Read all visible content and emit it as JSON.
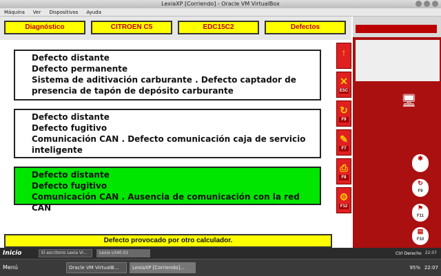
{
  "host": {
    "title": "LexiaXP [Corriendo] - Oracle VM VirtualBox",
    "menu": [
      "Máquina",
      "Ver",
      "Dispositivos",
      "Ayuda"
    ]
  },
  "guest": {
    "top_buttons": [
      "Diagnóstico",
      "CITROEN C5",
      "EDC15C2",
      "Defectos"
    ],
    "defects": [
      {
        "lines": [
          "Defecto distante",
          "Defecto permanente",
          "Sistema de aditivación carburante . Defecto captador de presencia de tapón de depósito carburante"
        ],
        "highlight": false
      },
      {
        "lines": [
          "Defecto distante",
          "Defecto fugitivo",
          "Comunicación CAN . Defecto comunicación caja de servicio inteligente"
        ],
        "highlight": true
      },
      {
        "lines": [
          "Defecto distante",
          "Defecto fugitivo",
          "Comunicación CAN . Ausencia de comunicación con la red CAN"
        ],
        "highlight": true
      }
    ],
    "status_message": "Defecto provocado por otro calculador.",
    "tool_buttons": [
      {
        "icon": "arrow-up-icon",
        "key": ""
      },
      {
        "icon": "erase-icon",
        "key": "ESC"
      },
      {
        "icon": "refresh-icon",
        "key": "F9"
      },
      {
        "icon": "pencil-icon",
        "key": "F7"
      },
      {
        "icon": "print-icon",
        "key": "F8"
      },
      {
        "icon": "tools-icon",
        "key": "F12"
      }
    ],
    "right_buttons": [
      {
        "key": ""
      },
      {
        "key": "F9"
      },
      {
        "key": "F11"
      },
      {
        "key": "F10"
      }
    ]
  },
  "guest_taskbar": {
    "start_label": "Inicio",
    "items": [
      "El escritorio Lexia VI...",
      "Lexia v340.01"
    ],
    "time": "22:07"
  },
  "host_taskbar": {
    "menu_label": "Menú",
    "items": [
      "Oracle VM VirtualB...",
      "LexiaXP [Corriendo]..."
    ],
    "battery": "95%",
    "clock": "22:07",
    "host_key": "Ctrl Derecho"
  }
}
